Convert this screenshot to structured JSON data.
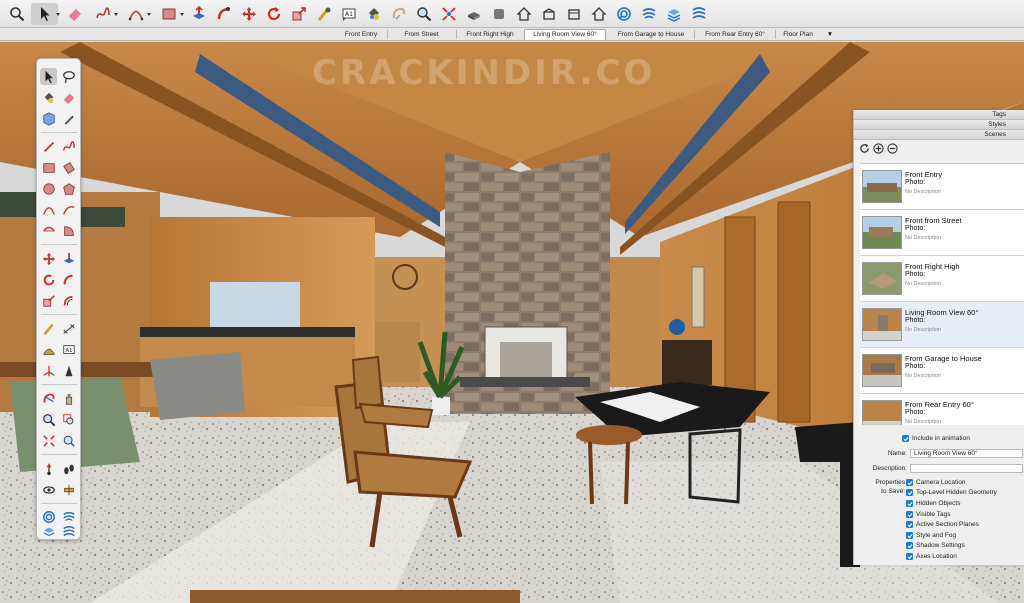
{
  "toolbar": {
    "tools": [
      "search-icon",
      "select-icon",
      "eraser-icon",
      "freehand-icon",
      "arc-icon",
      "rectangle-icon",
      "push-pull-icon",
      "follow-me-icon",
      "move-icon",
      "rotate-icon",
      "scale-icon",
      "tape-measure-icon",
      "text-icon",
      "paint-bucket-icon",
      "orbit-icon",
      "zoom-icon",
      "zoom-extents-icon",
      "3d-warehouse-icon",
      "iso-view-icon",
      "home-icon",
      "front-view-icon",
      "right-view-icon",
      "back-view-icon",
      "extension-warehouse-icon",
      "sandbox-icon",
      "layout-icon",
      "style-builder-icon"
    ]
  },
  "scene_tabs": {
    "items": [
      "Front Entry",
      "From Street",
      "Front Right High",
      "Living Room View 60°",
      "From Garage to House",
      "From Rear Entry 60°",
      "Floor Plan"
    ],
    "active": "Living Room View 60°",
    "overflow_icon": "▼"
  },
  "watermark": "CRACKINDIR.CO",
  "tray": {
    "panels": [
      "Tags",
      "Styles",
      "Scenes"
    ],
    "scenes": [
      {
        "name": "Front Entry",
        "photo": "Photo:",
        "description": "No Description"
      },
      {
        "name": "Front from Street",
        "photo": "Photo:",
        "description": "No Description"
      },
      {
        "name": "Front Right High",
        "photo": "Photo:",
        "description": "No Description"
      },
      {
        "name": "Living Room View 60°",
        "photo": "Photo:",
        "description": "No Description"
      },
      {
        "name": "From Garage to House",
        "photo": "Photo:",
        "description": "No Description"
      },
      {
        "name": "From Rear Entry 60°",
        "photo": "Photo:",
        "description": "No Description"
      }
    ],
    "selected_scene": "Living Room View 60°",
    "include_in_animation": "Include in animation",
    "name_label": "Name:",
    "name_value": "Living Room View 60°",
    "description_label": "Description:",
    "description_value": "",
    "properties_label_1": "Properties",
    "properties_label_2": "to Save:",
    "properties": [
      "Camera Location",
      "Top-Level Hidden Geometry",
      "Hidden Objects",
      "Visible Tags",
      "Active Section Planes",
      "Style and Fog",
      "Shadow Settings",
      "Axes Location"
    ]
  },
  "colors": {
    "accent": "#1a7ae6",
    "wood": "#b87a3e",
    "stone": "#8a7a6a",
    "floor": "#d9d6cf"
  }
}
